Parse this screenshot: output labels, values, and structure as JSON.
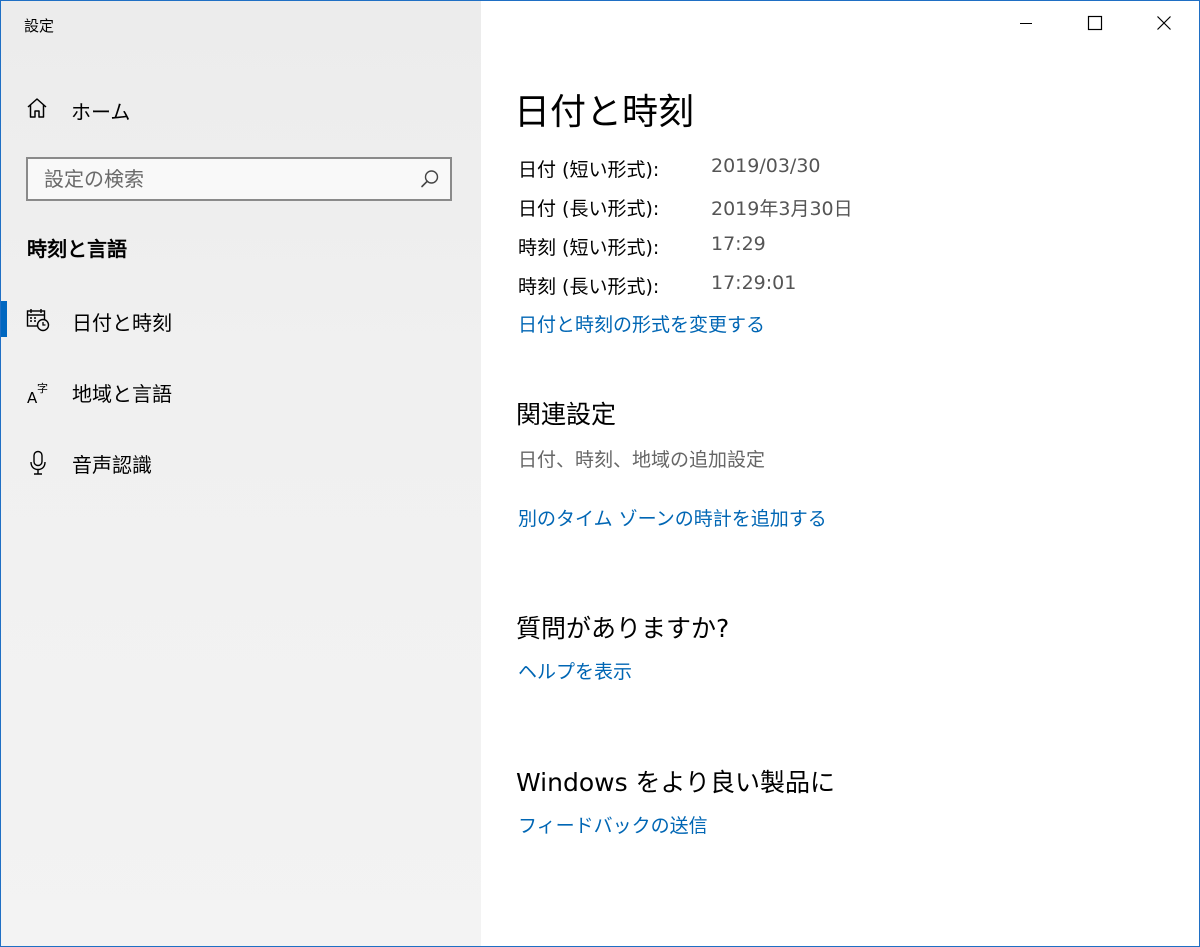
{
  "app": {
    "title": "設定"
  },
  "window_controls": {
    "minimize_icon": "minimize-icon",
    "maximize_icon": "maximize-icon",
    "close_icon": "close-icon"
  },
  "sidebar": {
    "home": {
      "label": "ホーム",
      "icon": "home-icon"
    },
    "search": {
      "placeholder": "設定の検索",
      "value": "",
      "icon": "search-icon"
    },
    "section_heading": "時刻と言語",
    "items": [
      {
        "label": "日付と時刻",
        "icon": "calendar-clock-icon",
        "active": true
      },
      {
        "label": "地域と言語",
        "icon": "language-icon",
        "active": false
      },
      {
        "label": "音声認識",
        "icon": "microphone-icon",
        "active": false
      }
    ]
  },
  "main": {
    "title": "日付と時刻",
    "rows": [
      {
        "label": "日付 (短い形式):",
        "value": "2019/03/30"
      },
      {
        "label": "日付 (長い形式):",
        "value": "2019年3月30日"
      },
      {
        "label": "時刻 (短い形式):",
        "value": "17:29"
      },
      {
        "label": "時刻 (長い形式):",
        "value": "17:29:01"
      }
    ],
    "change_format_link": "日付と時刻の形式を変更する",
    "related": {
      "heading": "関連設定",
      "additional_settings": "日付、時刻、地域の追加設定",
      "add_clock_link": "別のタイム ゾーンの時計を追加する"
    },
    "help": {
      "heading": "質問がありますか?",
      "link": "ヘルプを表示"
    },
    "feedback": {
      "heading": "Windows をより良い製品に",
      "link": "フィードバックの送信"
    }
  },
  "colors": {
    "accent": "#0067c0",
    "link": "#0066b4",
    "sidebar_bg": "#f0f0f0",
    "window_border": "#1f6fc4"
  }
}
